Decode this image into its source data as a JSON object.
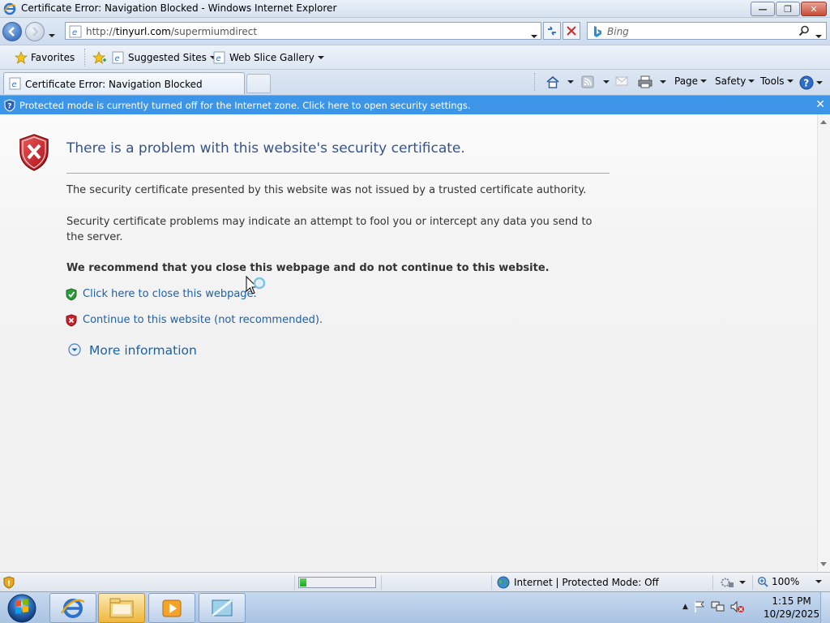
{
  "window": {
    "title": "Certificate Error: Navigation Blocked - Windows Internet Explorer"
  },
  "address_bar": {
    "url_prefix": "http://",
    "url_domain": "tinyurl.com",
    "url_path": "/supermiumdirect"
  },
  "search": {
    "placeholder": "Bing"
  },
  "favorites_bar": {
    "favorites_label": "Favorites",
    "suggested_sites_label": "Suggested Sites",
    "web_slice_gallery_label": "Web Slice Gallery"
  },
  "tab": {
    "title": "Certificate Error: Navigation Blocked"
  },
  "command_bar": {
    "page_label": "Page",
    "safety_label": "Safety",
    "tools_label": "Tools"
  },
  "info_bar": {
    "message": "Protected mode is currently turned off for the Internet zone.  Click here to open security settings."
  },
  "content": {
    "heading": "There is a problem with this website's security certificate.",
    "paragraph1": "The security certificate presented by this website was not issued by a trusted certificate authority.",
    "paragraph2": "Security certificate problems may indicate an attempt to fool you or intercept any data you send to the server.",
    "recommendation": "We recommend that you close this webpage and do not continue to this website.",
    "close_link": "Click here to close this webpage.",
    "continue_link": "Continue to this website (not recommended).",
    "more_information": "More information"
  },
  "status_bar": {
    "zone_text": "Internet | Protected Mode: Off",
    "zoom": "100%",
    "progress": 0.08
  },
  "taskbar": {
    "time": "1:15 PM",
    "date": "10/29/2025"
  },
  "colors": {
    "heading": "#35538a",
    "link": "#1a61a8",
    "info_bar": "#3d95e8",
    "error_red": "#c8222a"
  }
}
